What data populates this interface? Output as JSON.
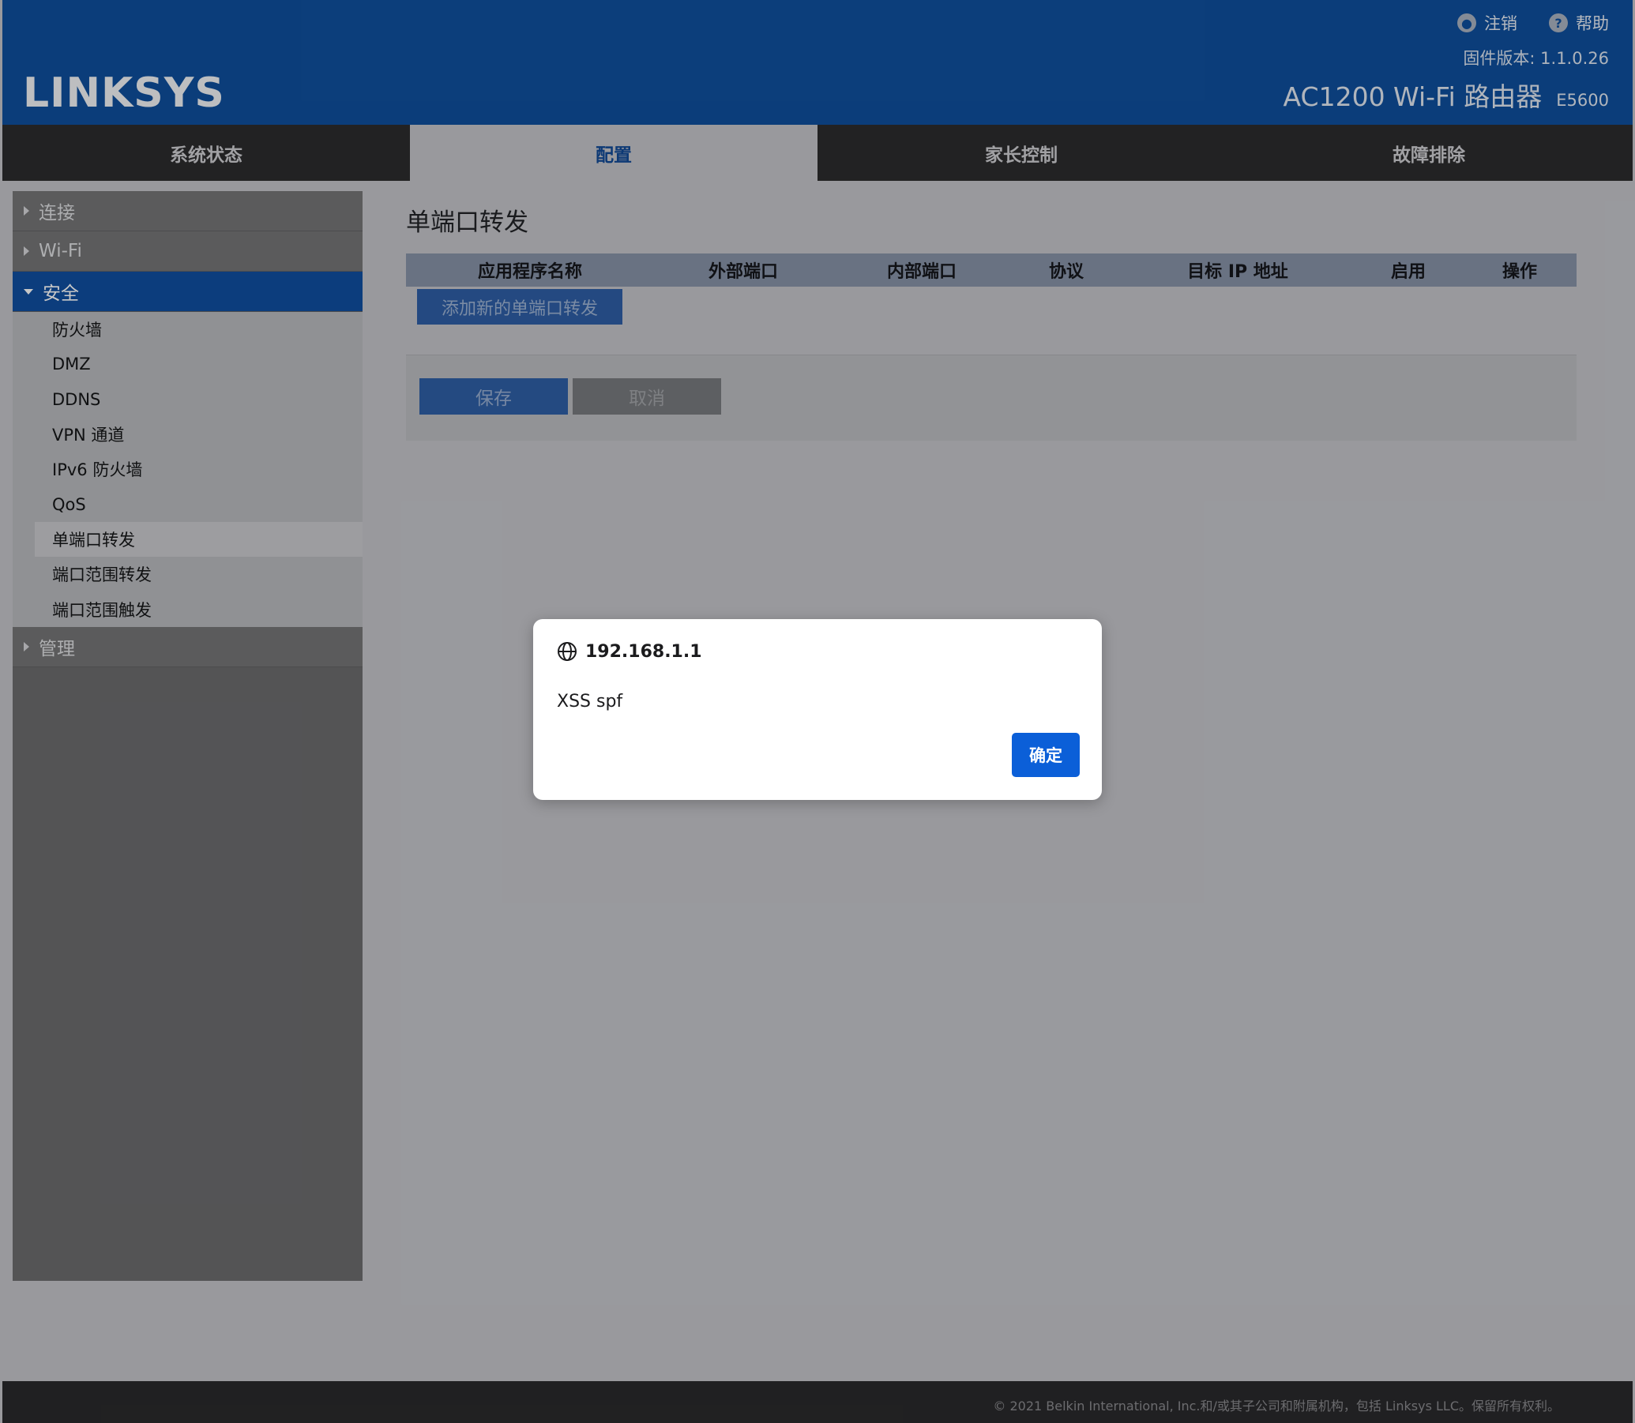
{
  "header": {
    "logo": "LINKSYS",
    "logout_label": "注销",
    "help_label": "帮助",
    "firmware": "固件版本: 1.1.0.26",
    "model_name": "AC1200 Wi-Fi 路由器",
    "model_code": "E5600"
  },
  "nav": {
    "tabs": [
      {
        "label": "系统状态"
      },
      {
        "label": "配置",
        "active": true
      },
      {
        "label": "家长控制"
      },
      {
        "label": "故障排除"
      }
    ]
  },
  "sidebar": {
    "sections": [
      {
        "label": "连接"
      },
      {
        "label": "Wi-Fi"
      },
      {
        "label": "安全",
        "open": true
      },
      {
        "label": "管理"
      }
    ],
    "security_items": [
      {
        "label": "防火墙"
      },
      {
        "label": "DMZ"
      },
      {
        "label": "DDNS"
      },
      {
        "label": "VPN 通道"
      },
      {
        "label": "IPv6 防火墙"
      },
      {
        "label": "QoS"
      },
      {
        "label": "单端口转发",
        "active": true
      },
      {
        "label": "端口范围转发"
      },
      {
        "label": "端口范围触发"
      }
    ]
  },
  "main": {
    "title": "单端口转发",
    "columns": [
      "应用程序名称",
      "外部端口",
      "内部端口",
      "协议",
      "目标 IP 地址",
      "启用",
      "操作"
    ],
    "add_button": "添加新的单端口转发",
    "save_button": "保存",
    "cancel_button": "取消"
  },
  "dialog": {
    "origin": "192.168.1.1",
    "message": "XSS spf",
    "ok_button": "确定"
  },
  "footer": {
    "copyright": "© 2021 Belkin International, Inc.和/或其子公司和附属机构，包括 Linksys LLC。保留所有权利。"
  },
  "colors": {
    "header_blue": "#0f4f9d",
    "nav_dark": "#2c2c2e",
    "dialog_button": "#0b5fd8"
  }
}
